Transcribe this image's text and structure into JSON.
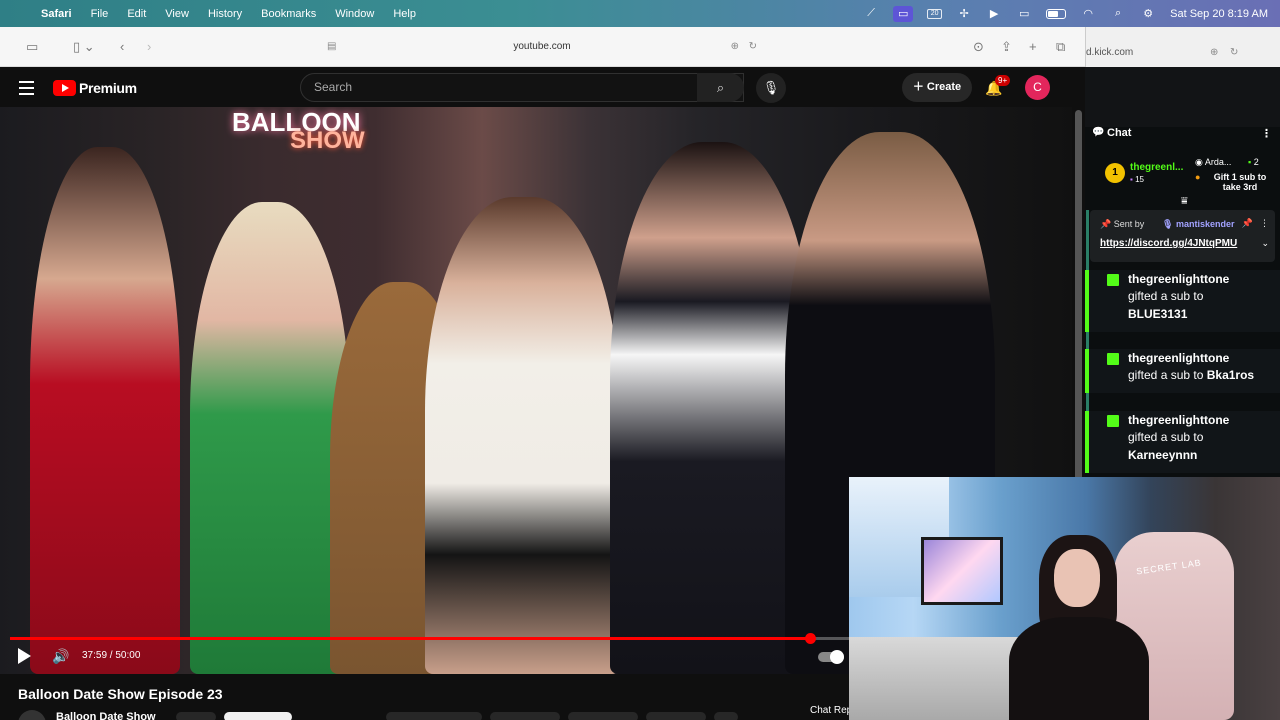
{
  "menubar": {
    "apple": "",
    "items": [
      "Safari",
      "File",
      "Edit",
      "View",
      "History",
      "Bookmarks",
      "Window",
      "Help"
    ],
    "datetime": "Sat Sep 20  8:19 AM",
    "status_icons": [
      "broadcast-icon",
      "screen-share-icon",
      "calendar-20-icon",
      "airdrop-icon",
      "play-circle-icon",
      "display-icon",
      "battery-icon",
      "wifi-icon",
      "search-icon",
      "control-center-icon"
    ]
  },
  "safari": {
    "address": "youtube.com"
  },
  "youtube": {
    "logo_text": "Premium",
    "search_placeholder": "Search",
    "create_label": "Create",
    "notifications_badge": "9+",
    "avatar_initial": "C",
    "video": {
      "sign_line1": "BALLOON",
      "sign_line2": "SHOW",
      "time": "37:59 / 50:00",
      "progress": 0.76
    },
    "title": "Balloon Date Show Episode 23",
    "channel": "Balloon Date Show",
    "chat_replay": "Chat Rep"
  },
  "kick": {
    "address": "d.kick.com",
    "chat_title": "Chat",
    "leaderboard": {
      "first": {
        "rank": "1",
        "name": "thegreenl...",
        "count": "15"
      },
      "second": {
        "name": "Arda...",
        "count": "2"
      },
      "third": {
        "rank": "3",
        "text": "Gift 1 sub to take 3rd"
      }
    },
    "pinned": {
      "sent_by": "Sent by",
      "user": "mantiskender",
      "link": "https://discord.gg/4JNtqPMU"
    },
    "messages": [
      {
        "user": "thegreenlighttone",
        "text": "gifted a sub to",
        "target": "BLUE3131"
      },
      {
        "user": "thegreenlighttone",
        "text": "gifted a sub to",
        "target": "Bka1ros"
      },
      {
        "user": "thegreenlighttone",
        "text": "gifted a sub to",
        "target": "Karneeynnn"
      }
    ]
  },
  "webcam": {
    "chair_label": "SECRET LAB"
  },
  "colors": {
    "youtube_red": "#ff0000",
    "kick_green": "#53fc18",
    "avatar_pink": "#e3265c"
  }
}
